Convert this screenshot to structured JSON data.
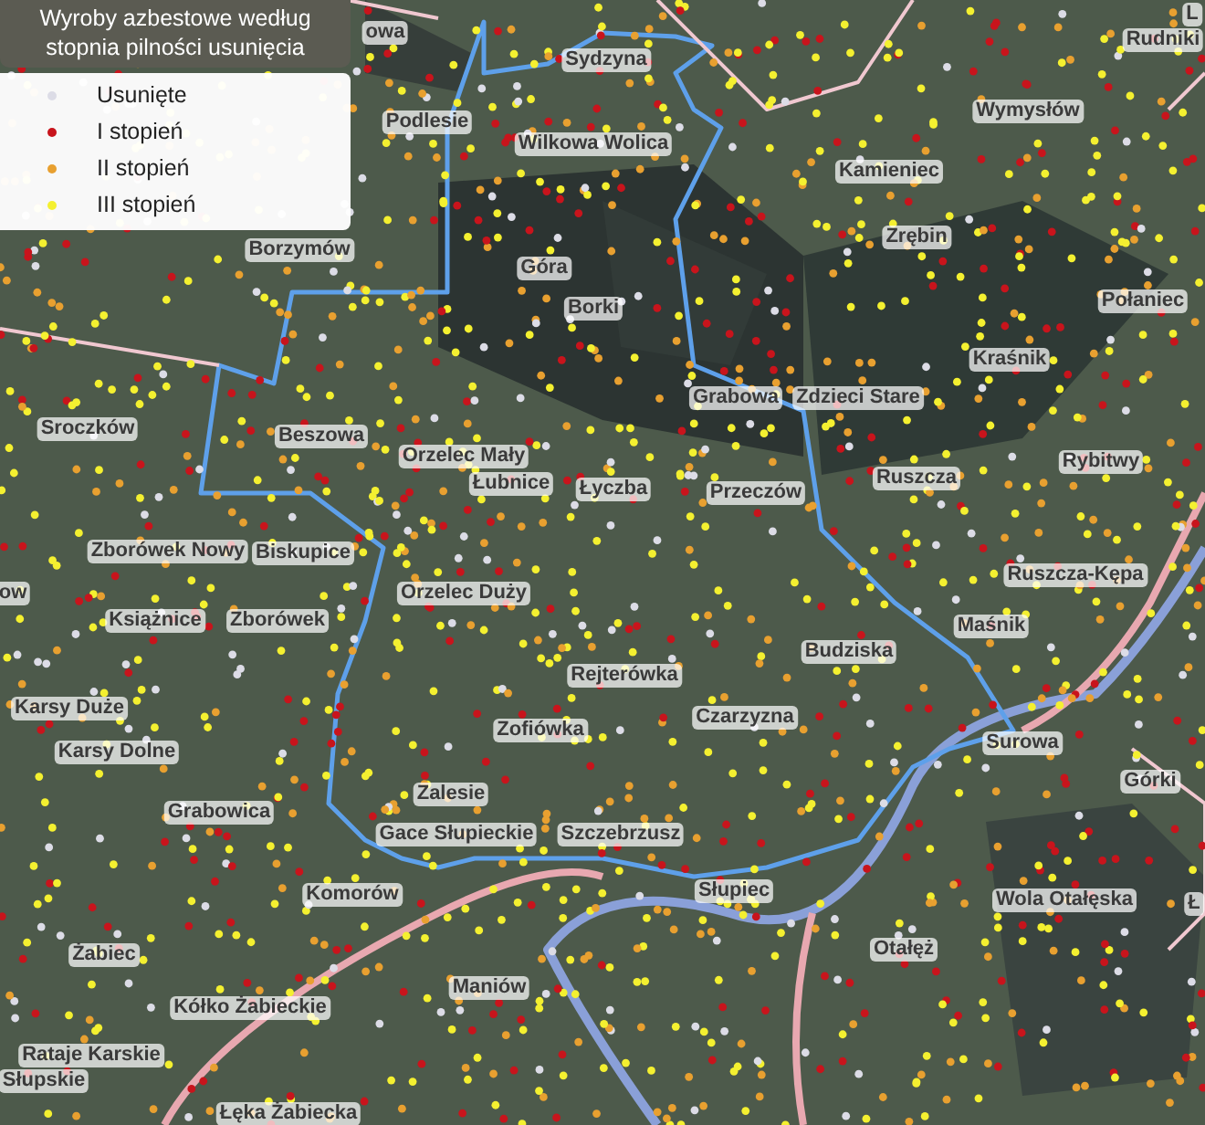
{
  "legend": {
    "title": "Wyroby azbestowe według stopnia pilności usunięcia",
    "items": [
      {
        "label": "Usunięte",
        "color": "#dcdce6"
      },
      {
        "label": "I stopień",
        "color": "#c8141c"
      },
      {
        "label": "II stopień",
        "color": "#e8a030"
      },
      {
        "label": "III stopień",
        "color": "#f4f030"
      }
    ]
  },
  "places": [
    "owa",
    "L",
    "Sydzyna",
    "Rudniki",
    "Podlesie",
    "Wilkowa Wolica",
    "Wymysłów",
    "Kamieniec",
    "Zrębin",
    "Borzymów",
    "Góra",
    "Borki",
    "Połaniec",
    "Kraśnik",
    "Grabowa",
    "Zdzieci Stare",
    "Sroczków",
    "Beszowa",
    "Orzelec Mały",
    "Łubnice",
    "Łyczba",
    "Przeczów",
    "Ruszcza",
    "Rybitwy",
    "Zborówek Nowy",
    "Biskupice",
    "Ruszcza-Kępa",
    "Orzelec Duży",
    "ow",
    "Książnice",
    "Zborówek",
    "Maśnik",
    "Budziska",
    "Rejterówka",
    "Karsy Duże",
    "Czarzyzna",
    "Zofiówka",
    "Surowa",
    "Karsy Dolne",
    "Górki",
    "Grabowica",
    "Zalesie",
    "Gace Słupieckie",
    "Szczebrzusz",
    "Słupiec",
    "Wola Otałęska",
    "Ł",
    "Komorów",
    "Otałęż",
    "Żabiec",
    "Kółko Żabieckie",
    "Maniów",
    "Rataje Karskie",
    "Słupskie",
    "Łęka Żabiecka"
  ]
}
